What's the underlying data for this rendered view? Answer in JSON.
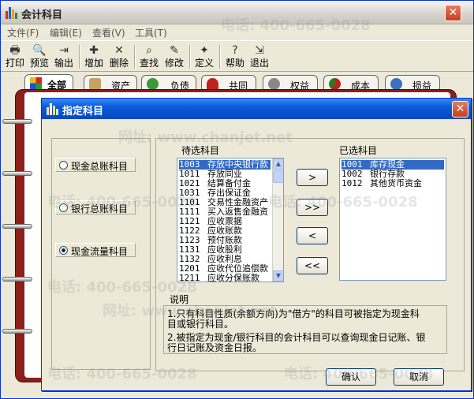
{
  "window": {
    "title": "会计科目",
    "close_glyph": "✕"
  },
  "menu": [
    {
      "label": "文件(F)"
    },
    {
      "label": "编辑(E)"
    },
    {
      "label": "查看(V)"
    },
    {
      "label": "工具(T)"
    }
  ],
  "toolbar": [
    {
      "label": "打印",
      "icon": "printer-icon",
      "glyph": "🖶"
    },
    {
      "label": "预览",
      "icon": "preview-icon",
      "glyph": "🔍"
    },
    {
      "label": "输出",
      "icon": "export-icon",
      "glyph": "⇥"
    },
    {
      "label": "增加",
      "icon": "add-icon",
      "glyph": "✚"
    },
    {
      "label": "删除",
      "icon": "delete-icon",
      "glyph": "✕"
    },
    {
      "label": "查找",
      "icon": "find-icon",
      "glyph": "⌕"
    },
    {
      "label": "修改",
      "icon": "edit-icon",
      "glyph": "✎"
    },
    {
      "label": "定义",
      "icon": "define-icon",
      "glyph": "✦"
    },
    {
      "label": "帮助",
      "icon": "help-icon",
      "glyph": "?"
    },
    {
      "label": "退出",
      "icon": "exit-icon",
      "glyph": "⇲"
    }
  ],
  "tabs": [
    {
      "label": "全部",
      "active": true
    },
    {
      "label": "资产"
    },
    {
      "label": "负债"
    },
    {
      "label": "共同"
    },
    {
      "label": "权益"
    },
    {
      "label": "成本"
    },
    {
      "label": "损益"
    }
  ],
  "dialog": {
    "title": "指定科目",
    "close_glyph": "✕",
    "radios": [
      {
        "label": "现金总账科目",
        "checked": false
      },
      {
        "label": "银行总账科目",
        "checked": false
      },
      {
        "label": "现金流量科目",
        "checked": true
      }
    ],
    "available_label": "待选科目",
    "selected_label": "已选科目",
    "available": [
      {
        "code": "1003",
        "name": "存放中央银行款",
        "selected": true
      },
      {
        "code": "1011",
        "name": "存放同业"
      },
      {
        "code": "1021",
        "name": "结算备付金"
      },
      {
        "code": "1031",
        "name": "存出保证金"
      },
      {
        "code": "1101",
        "name": "交易性金融资产"
      },
      {
        "code": "1111",
        "name": "买入返售金融资"
      },
      {
        "code": "1121",
        "name": "应收票据"
      },
      {
        "code": "1122",
        "name": "应收账款"
      },
      {
        "code": "1123",
        "name": "预付账款"
      },
      {
        "code": "1131",
        "name": "应收股利"
      },
      {
        "code": "1132",
        "name": "应收利息"
      },
      {
        "code": "1201",
        "name": "应收代位追偿款"
      },
      {
        "code": "1211",
        "name": "应收分保账款"
      }
    ],
    "chosen": [
      {
        "code": "1001",
        "name": "库存现金",
        "selected": true
      },
      {
        "code": "1002",
        "name": "银行存款"
      },
      {
        "code": "1012",
        "name": "其他货币资金"
      }
    ],
    "move_buttons": {
      "add_one": ">",
      "add_all": ">>",
      "remove_one": "<",
      "remove_all": "<<"
    },
    "description_label": "说明",
    "description": [
      "1.只有科目性质(余额方向)为\"借方\"的科目可被指定为现金科",
      "目或银行科目。",
      "2.被指定为现金/银行科目的会计科目可以查询现金日记账、银",
      "行日记账及资金日报。"
    ],
    "ok_label": "确认",
    "cancel_label": "取消"
  },
  "watermarks": [
    "电话: 400-665-0028",
    "网址: www.chanjet.net"
  ],
  "colors": {
    "dialog_title_bg": "#0a5ad9",
    "selection": "#316ac5",
    "binder": "#8b1f1a"
  }
}
